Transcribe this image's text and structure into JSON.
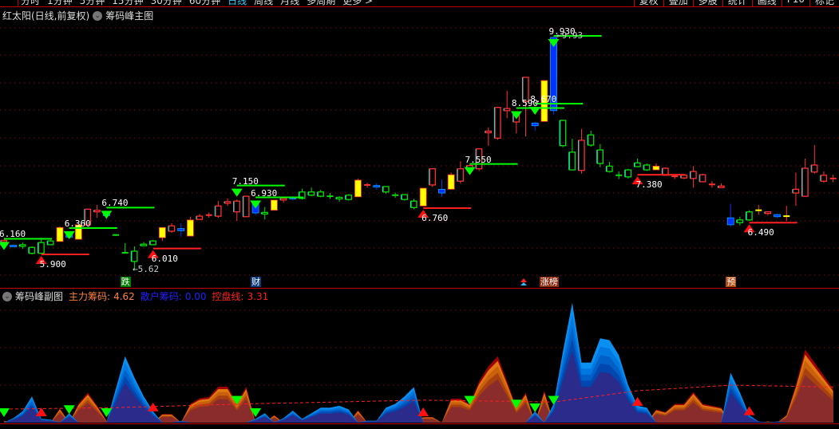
{
  "topbar": {
    "menu": [
      "分时",
      "1分钟",
      "5分钟",
      "15分钟",
      "30分钟",
      "60分钟",
      "日线",
      "周线",
      "月线",
      "多周期",
      "更多 >"
    ],
    "active": "日线",
    "right_buttons": [
      "复权",
      "叠加",
      "多股",
      "统计",
      "画线",
      "F10",
      "标记"
    ]
  },
  "main": {
    "title": "红太阳(日线,前复权)",
    "indicator": "筹码峰主图",
    "low_note": "←5.62",
    "high_note": "←9.93"
  },
  "sub": {
    "title": "筹码峰副图",
    "main_chip_label": "主力筹码:",
    "main_chip_value": "4.62",
    "retail_chip_label": "散户筹码:",
    "retail_chip_value": "0.00",
    "control_label": "控盘线:",
    "control_value": "3.31",
    "colors": {
      "main": "#ff8040",
      "retail": "#2020ff",
      "control": "#ff2020"
    }
  },
  "badges": [
    {
      "text": "跌",
      "idx": 13,
      "bg": "#008000"
    },
    {
      "text": "财",
      "idx": 27,
      "bg": "#0a3a7a"
    },
    {
      "text": "涨榜",
      "idx": 58,
      "bg": "#8b2a10"
    },
    {
      "text": "预",
      "idx": 78,
      "bg": "#b04a10"
    }
  ],
  "chart_data": {
    "type": "candlestick",
    "price_range": [
      5.2,
      10.1
    ],
    "candles": [
      [
        6.14,
        6.17,
        6.12,
        6.16,
        "r"
      ],
      [
        6.07,
        6.08,
        6.04,
        6.05,
        "b"
      ],
      [
        6.08,
        6.12,
        6.0,
        6.05,
        "g"
      ],
      [
        6.03,
        6.05,
        5.9,
        5.92,
        "g"
      ],
      [
        6.12,
        6.21,
        5.92,
        5.92,
        "g"
      ],
      [
        6.15,
        6.17,
        6.08,
        6.08,
        "g"
      ],
      [
        6.14,
        6.42,
        6.14,
        6.4,
        "y"
      ],
      [
        6.26,
        6.28,
        6.2,
        6.22,
        "b"
      ],
      [
        6.18,
        6.45,
        6.18,
        6.45,
        "y"
      ],
      [
        6.45,
        6.74,
        6.45,
        6.74,
        "r"
      ],
      [
        6.7,
        6.82,
        6.58,
        6.72,
        "r"
      ],
      [
        6.65,
        6.66,
        6.55,
        6.62,
        "b"
      ],
      [
        6.26,
        6.28,
        6.24,
        6.26,
        "gx"
      ],
      [
        5.93,
        6.11,
        5.93,
        5.93,
        "gx"
      ],
      [
        5.96,
        6.05,
        5.62,
        5.77,
        "g"
      ],
      [
        6.09,
        6.13,
        6.06,
        6.07,
        "g"
      ],
      [
        6.15,
        6.17,
        6.08,
        6.08,
        "g"
      ],
      [
        6.21,
        6.4,
        6.15,
        6.4,
        "y"
      ],
      [
        6.33,
        6.48,
        6.3,
        6.43,
        "r"
      ],
      [
        6.38,
        6.48,
        6.23,
        6.34,
        "b"
      ],
      [
        6.24,
        6.6,
        6.24,
        6.54,
        "y"
      ],
      [
        6.55,
        6.65,
        6.55,
        6.61,
        "r"
      ],
      [
        6.63,
        6.68,
        6.58,
        6.63,
        "rx"
      ],
      [
        6.61,
        6.89,
        6.58,
        6.8,
        "r"
      ],
      [
        6.86,
        6.94,
        6.8,
        6.88,
        "r"
      ],
      [
        6.69,
        6.92,
        6.52,
        6.89,
        "r"
      ],
      [
        6.6,
        6.98,
        6.6,
        6.98,
        "r"
      ],
      [
        6.85,
        6.87,
        6.62,
        6.67,
        "b"
      ],
      [
        6.68,
        6.78,
        6.55,
        6.66,
        "g"
      ],
      [
        6.72,
        6.91,
        6.72,
        6.91,
        "y"
      ],
      [
        6.92,
        6.96,
        6.86,
        6.94,
        "r"
      ],
      [
        6.96,
        6.98,
        6.9,
        6.93,
        "b"
      ],
      [
        7.06,
        7.12,
        6.92,
        6.94,
        "g"
      ],
      [
        7.06,
        7.14,
        6.98,
        7.0,
        "g"
      ],
      [
        7.06,
        7.1,
        6.96,
        6.98,
        "g"
      ],
      [
        6.98,
        7.04,
        6.93,
        6.98,
        "gx"
      ],
      [
        6.96,
        6.98,
        6.88,
        6.95,
        "g"
      ],
      [
        7.0,
        7.02,
        6.9,
        6.92,
        "g"
      ],
      [
        6.97,
        7.31,
        6.97,
        7.28,
        "y"
      ],
      [
        7.19,
        7.23,
        7.14,
        7.19,
        "rx"
      ],
      [
        7.18,
        7.22,
        7.1,
        7.16,
        "b"
      ],
      [
        7.16,
        7.16,
        7.03,
        7.06,
        "g"
      ],
      [
        7.0,
        7.05,
        6.95,
        7.0,
        "gx"
      ],
      [
        7.01,
        7.01,
        6.9,
        6.92,
        "g"
      ],
      [
        6.89,
        6.93,
        6.74,
        6.77,
        "g"
      ],
      [
        6.8,
        7.13,
        6.8,
        7.13,
        "y"
      ],
      [
        7.19,
        7.49,
        7.15,
        7.49,
        "r"
      ],
      [
        7.11,
        7.29,
        6.97,
        7.04,
        "b"
      ],
      [
        7.11,
        7.42,
        7.11,
        7.38,
        "y"
      ],
      [
        7.26,
        7.63,
        7.22,
        7.49,
        "r"
      ],
      [
        7.47,
        7.58,
        7.4,
        7.55,
        "r"
      ],
      [
        7.49,
        7.86,
        7.45,
        7.86,
        "r"
      ],
      [
        8.16,
        8.26,
        7.92,
        8.19,
        "r"
      ],
      [
        8.06,
        8.63,
        8.03,
        8.63,
        "r"
      ],
      [
        8.57,
        8.94,
        8.43,
        8.61,
        "r"
      ],
      [
        8.36,
        8.52,
        8.15,
        8.52,
        "r"
      ],
      [
        8.74,
        9.19,
        8.09,
        9.19,
        "r"
      ],
      [
        8.34,
        8.36,
        8.2,
        8.29,
        "b"
      ],
      [
        8.37,
        9.13,
        8.37,
        9.13,
        "y"
      ],
      [
        9.93,
        9.93,
        8.5,
        8.57,
        "b"
      ],
      [
        8.39,
        8.39,
        7.89,
        7.92,
        "g"
      ],
      [
        7.8,
        8.05,
        7.47,
        7.47,
        "g"
      ],
      [
        7.46,
        8.23,
        7.4,
        8.02,
        "r"
      ],
      [
        8.12,
        8.2,
        7.9,
        7.93,
        "g"
      ],
      [
        7.84,
        7.95,
        7.52,
        7.59,
        "g"
      ],
      [
        7.54,
        7.62,
        7.42,
        7.44,
        "g"
      ],
      [
        7.37,
        7.44,
        7.3,
        7.37,
        "gx"
      ],
      [
        7.47,
        7.49,
        7.31,
        7.34,
        "g"
      ],
      [
        7.6,
        7.68,
        7.53,
        7.53,
        "g"
      ],
      [
        7.56,
        7.59,
        7.45,
        7.47,
        "g"
      ],
      [
        7.47,
        7.59,
        7.47,
        7.54,
        "y"
      ],
      [
        7.37,
        7.52,
        7.37,
        7.5,
        "r"
      ],
      [
        7.35,
        7.38,
        7.3,
        7.35,
        "rx"
      ],
      [
        7.32,
        7.38,
        7.3,
        7.37,
        "r"
      ],
      [
        7.31,
        7.54,
        7.14,
        7.44,
        "r"
      ],
      [
        7.25,
        7.4,
        7.25,
        7.38,
        "r"
      ],
      [
        7.2,
        7.26,
        7.14,
        7.2,
        "rx"
      ],
      [
        7.15,
        7.22,
        7.15,
        7.17,
        "r"
      ],
      [
        6.58,
        6.84,
        6.42,
        6.45,
        "b"
      ],
      [
        6.54,
        6.6,
        6.44,
        6.49,
        "g"
      ],
      [
        6.69,
        6.72,
        6.52,
        6.54,
        "g"
      ],
      [
        6.72,
        6.82,
        6.64,
        6.72,
        "yx"
      ],
      [
        6.66,
        6.7,
        6.63,
        6.69,
        "r"
      ],
      [
        6.64,
        6.66,
        6.57,
        6.6,
        "b"
      ],
      [
        6.61,
        6.8,
        6.52,
        6.61,
        "yx"
      ],
      [
        7.04,
        7.42,
        6.8,
        7.11,
        "r"
      ],
      [
        6.98,
        7.68,
        6.98,
        7.5,
        "r"
      ],
      [
        7.43,
        7.93,
        7.4,
        7.56,
        "r"
      ],
      [
        7.26,
        7.44,
        7.23,
        7.37,
        "r"
      ],
      [
        7.31,
        7.38,
        7.24,
        7.31,
        "rx"
      ]
    ],
    "signals": [
      {
        "idx": 0,
        "price": 6.16,
        "type": "sell",
        "label": "6.160"
      },
      {
        "idx": 4,
        "price": 5.9,
        "type": "buy",
        "label": "5.900"
      },
      {
        "idx": 7,
        "price": 6.36,
        "type": "sell",
        "label": "6.360"
      },
      {
        "idx": 11,
        "price": 6.74,
        "type": "sell",
        "label": "6.740"
      },
      {
        "idx": 16,
        "price": 6.01,
        "type": "buy",
        "label": "6.010"
      },
      {
        "idx": 25,
        "price": 7.15,
        "type": "sell",
        "label": "7.150"
      },
      {
        "idx": 27,
        "price": 6.93,
        "type": "sell",
        "label": "6.930"
      },
      {
        "idx": 45,
        "price": 6.76,
        "type": "buy",
        "label": "6.760"
      },
      {
        "idx": 50,
        "price": 7.55,
        "type": "sell",
        "label": "7.550"
      },
      {
        "idx": 55,
        "price": 8.59,
        "type": "sell",
        "label": "8.590"
      },
      {
        "idx": 57,
        "price": 8.67,
        "type": "sell",
        "label": "8.670"
      },
      {
        "idx": 59,
        "price": 9.93,
        "type": "sell",
        "label": "9.930"
      },
      {
        "idx": 68,
        "price": 7.38,
        "type": "buy",
        "label": "7.380"
      },
      {
        "idx": 80,
        "price": 6.49,
        "type": "buy",
        "label": "6.490"
      }
    ],
    "chip_peaks": [
      [
        0.05,
        "r"
      ],
      [
        0.12,
        "b"
      ],
      [
        0.3,
        "b"
      ],
      [
        0.7,
        "b"
      ],
      [
        0.1,
        "b"
      ],
      [
        0.08,
        "b"
      ],
      [
        0.38,
        "r"
      ],
      [
        0.25,
        "b"
      ],
      [
        0.5,
        "r"
      ],
      [
        0.8,
        "r"
      ],
      [
        0.45,
        "r"
      ],
      [
        0.05,
        "r"
      ],
      [
        0.9,
        "b"
      ],
      [
        1.77,
        "b"
      ],
      [
        1.2,
        "b"
      ],
      [
        0.7,
        "b"
      ],
      [
        0.3,
        "b"
      ],
      [
        0.23,
        "r"
      ],
      [
        0.23,
        "r"
      ],
      [
        0.05,
        "b"
      ],
      [
        0.5,
        "r"
      ],
      [
        0.65,
        "r"
      ],
      [
        0.68,
        "r"
      ],
      [
        0.96,
        "r"
      ],
      [
        0.96,
        "r"
      ],
      [
        0.5,
        "r"
      ],
      [
        0.96,
        "r"
      ],
      [
        0.1,
        "b"
      ],
      [
        0.25,
        "b"
      ],
      [
        0.2,
        "r"
      ],
      [
        0.12,
        "b"
      ],
      [
        0.32,
        "b"
      ],
      [
        0.1,
        "b"
      ],
      [
        0.25,
        "b"
      ],
      [
        0.4,
        "b"
      ],
      [
        0.4,
        "b"
      ],
      [
        0.45,
        "b"
      ],
      [
        0.35,
        "b"
      ],
      [
        0.33,
        "r"
      ],
      [
        0.05,
        "b"
      ],
      [
        0.05,
        "b"
      ],
      [
        0.4,
        "b"
      ],
      [
        0.5,
        "b"
      ],
      [
        0.7,
        "b"
      ],
      [
        0.95,
        "b"
      ],
      [
        0.15,
        "r"
      ],
      [
        0.15,
        "r"
      ],
      [
        0.0,
        "r"
      ],
      [
        0.64,
        "r"
      ],
      [
        0.64,
        "r"
      ],
      [
        0.5,
        "r"
      ],
      [
        1.1,
        "r"
      ],
      [
        1.5,
        "r"
      ],
      [
        1.77,
        "r"
      ],
      [
        1.1,
        "r"
      ],
      [
        0.4,
        "r"
      ],
      [
        0.8,
        "r"
      ],
      [
        0.3,
        "b"
      ],
      [
        0.85,
        "r"
      ],
      [
        0.5,
        "b"
      ],
      [
        1.9,
        "b"
      ],
      [
        3.2,
        "b"
      ],
      [
        1.6,
        "b"
      ],
      [
        1.6,
        "b"
      ],
      [
        2.25,
        "b"
      ],
      [
        2.2,
        "b"
      ],
      [
        1.8,
        "b"
      ],
      [
        1.0,
        "b"
      ],
      [
        0.45,
        "b"
      ],
      [
        0.4,
        "b"
      ],
      [
        0.35,
        "r"
      ],
      [
        0.28,
        "r"
      ],
      [
        0.5,
        "r"
      ],
      [
        0.5,
        "r"
      ],
      [
        0.82,
        "r"
      ],
      [
        0.5,
        "r"
      ],
      [
        0.45,
        "r"
      ],
      [
        0.4,
        "r"
      ],
      [
        1.33,
        "b"
      ],
      [
        0.8,
        "b"
      ],
      [
        0.2,
        "b"
      ],
      [
        0.03,
        "b"
      ],
      [
        0.03,
        "r"
      ],
      [
        0.03,
        "b"
      ],
      [
        0.2,
        "r"
      ],
      [
        1.0,
        "r"
      ],
      [
        1.95,
        "r"
      ],
      [
        1.6,
        "r"
      ],
      [
        1.25,
        "r"
      ],
      [
        0.9,
        "r"
      ]
    ],
    "control_line": [
      [
        0,
        0.36
      ],
      [
        12,
        0.4
      ],
      [
        26,
        0.5
      ],
      [
        45,
        0.6
      ],
      [
        59,
        0.55
      ],
      [
        68,
        0.85
      ],
      [
        78,
        1.0
      ],
      [
        89,
        0.95
      ]
    ],
    "sub_range": [
      0,
      3.3
    ]
  }
}
